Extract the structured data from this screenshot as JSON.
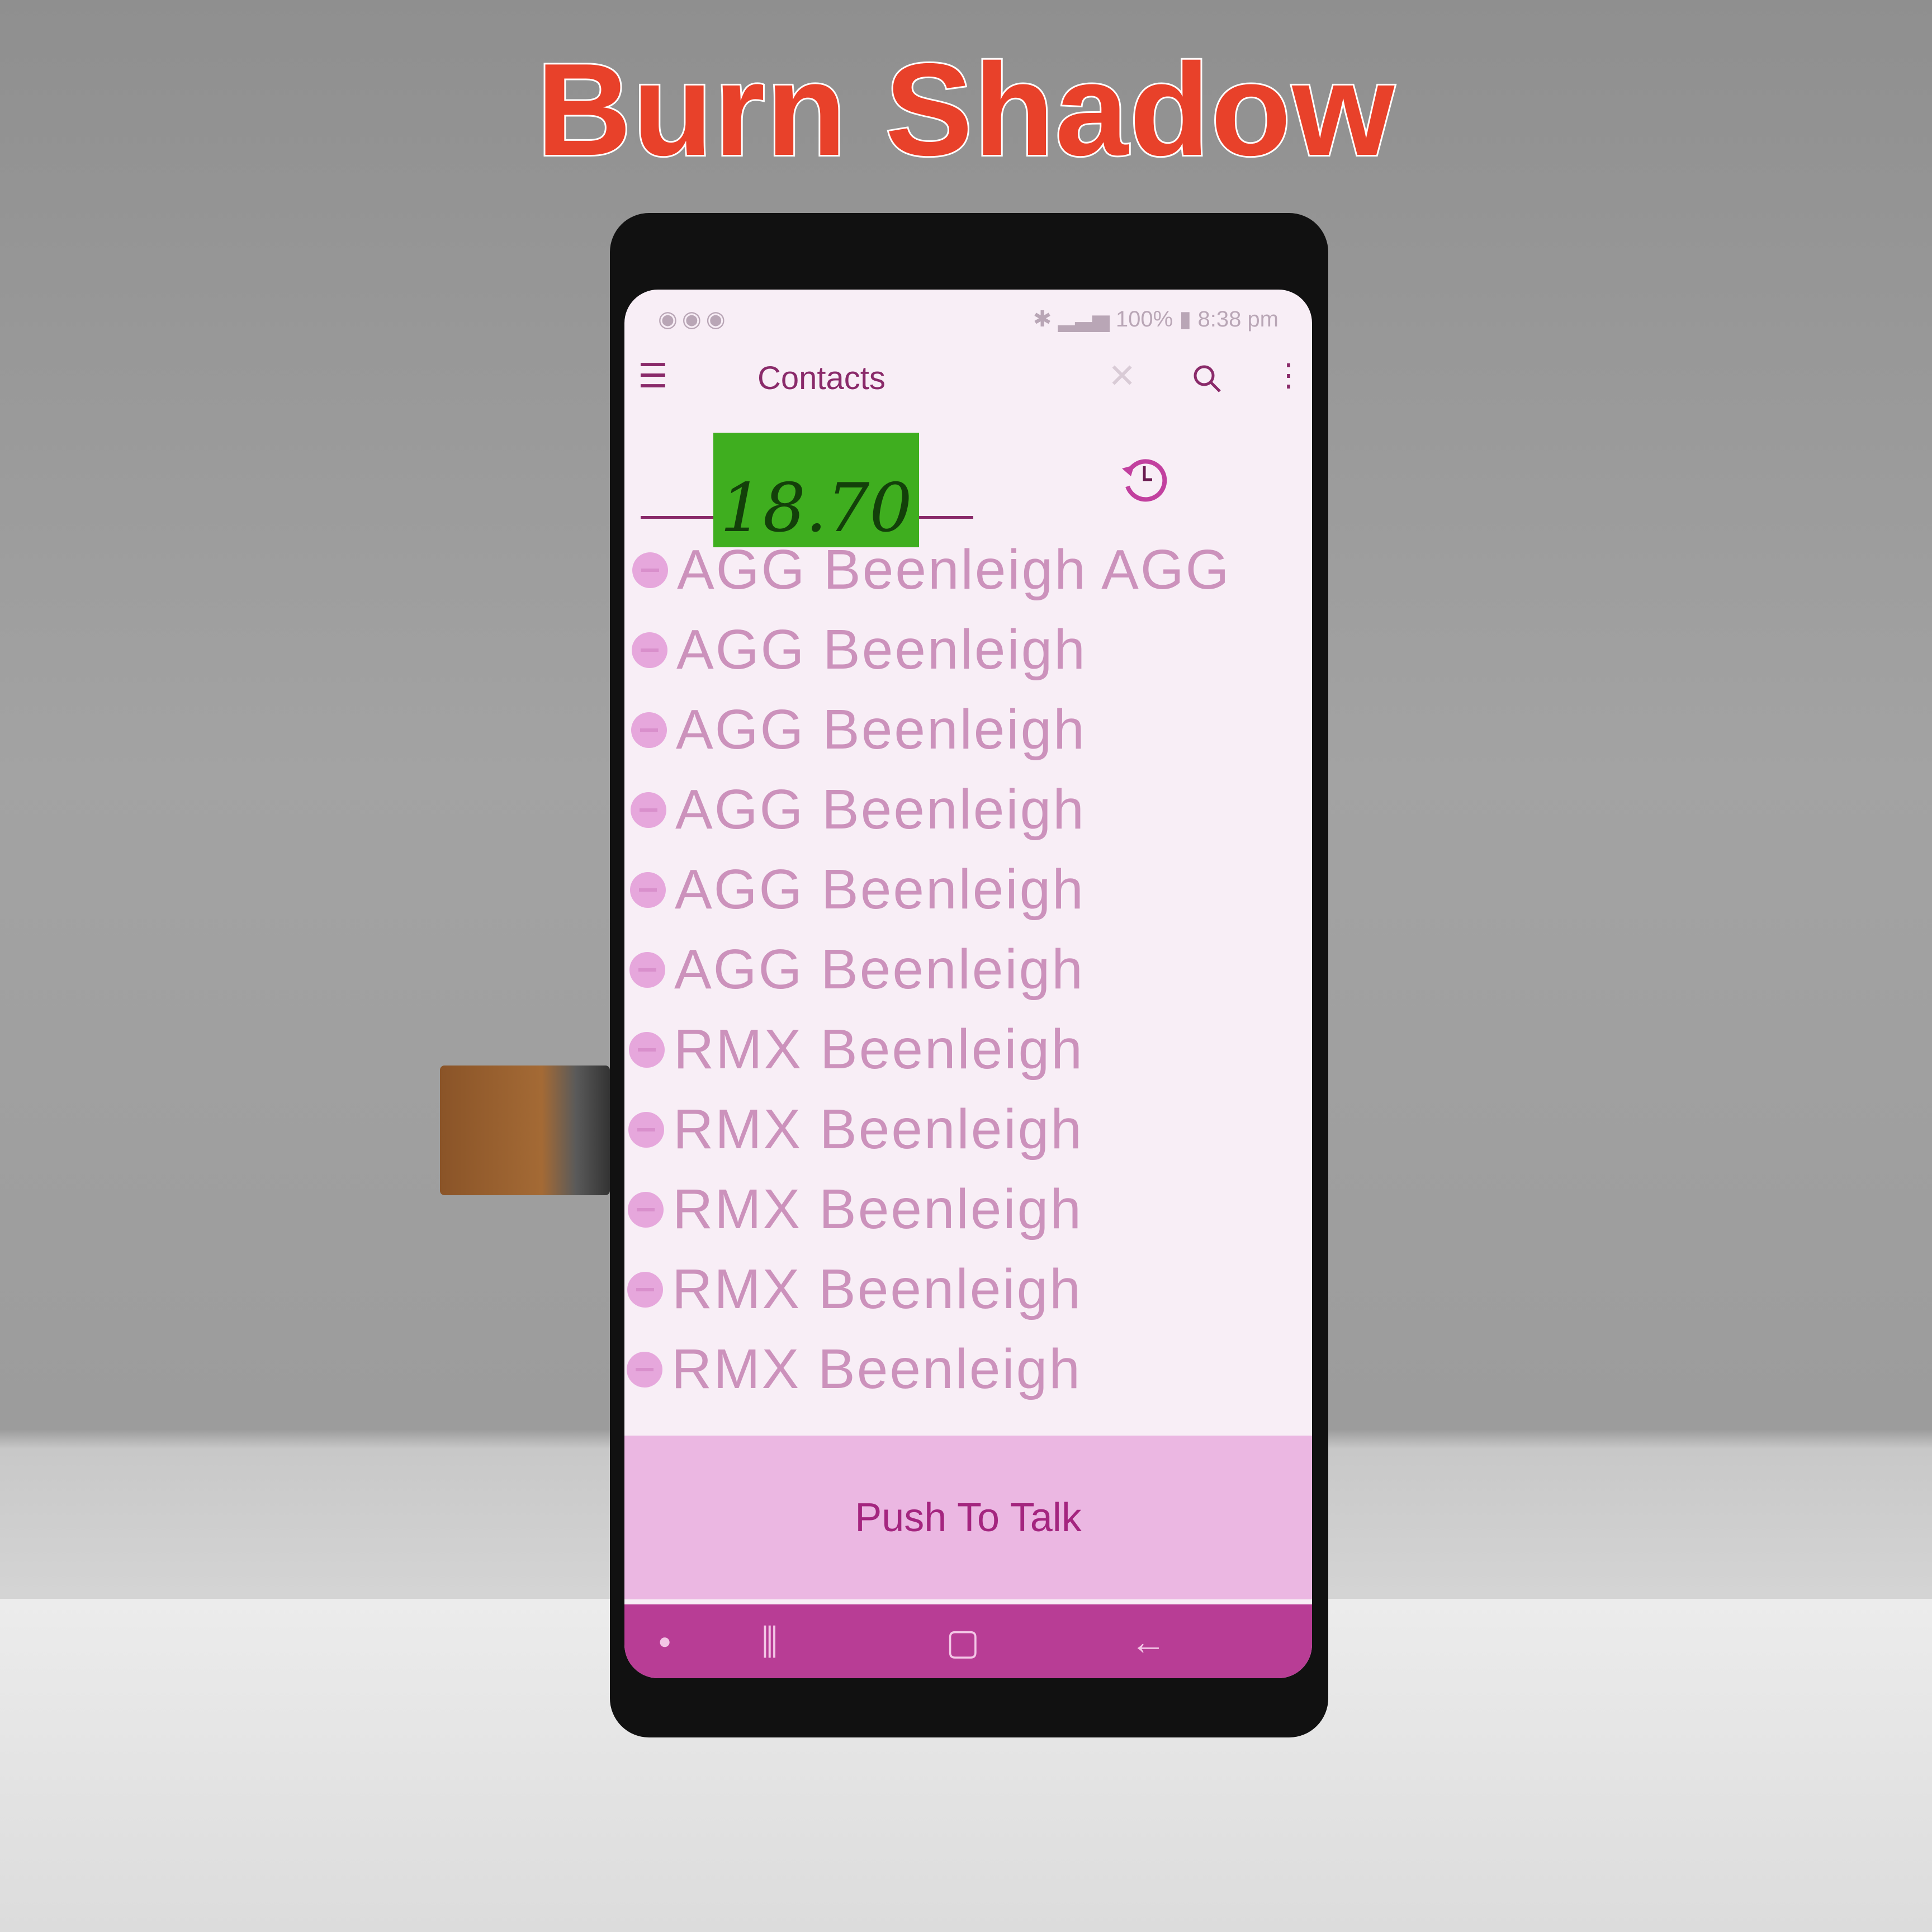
{
  "overlay_title": "Burn Shadow",
  "status_bar": {
    "battery": "100%",
    "time": "8:38 pm"
  },
  "header": {
    "title": "Contacts",
    "menu_icon": "hamburger-icon",
    "close_icon": "close-icon",
    "search_icon": "search-icon",
    "more_icon": "more-vert-icon"
  },
  "history_icon": "history-icon",
  "sticker": {
    "text": "18.70"
  },
  "contacts": [
    {
      "label": "AGG Beenleigh AGG"
    },
    {
      "label": "AGG Beenleigh"
    },
    {
      "label": "AGG Beenleigh"
    },
    {
      "label": "AGG Beenleigh"
    },
    {
      "label": "AGG Beenleigh"
    },
    {
      "label": "AGG Beenleigh"
    },
    {
      "label": "RMX Beenleigh"
    },
    {
      "label": "RMX Beenleigh"
    },
    {
      "label": "RMX Beenleigh"
    },
    {
      "label": "RMX Beenleigh"
    },
    {
      "label": "RMX Beenleigh"
    }
  ],
  "push_to_talk": {
    "label": "Push To Talk"
  },
  "colors": {
    "accent": "#8a2a6a",
    "nav_bar": "#b83d95",
    "ptt_bg": "#ebb7e2",
    "title_red": "#e8412a"
  }
}
